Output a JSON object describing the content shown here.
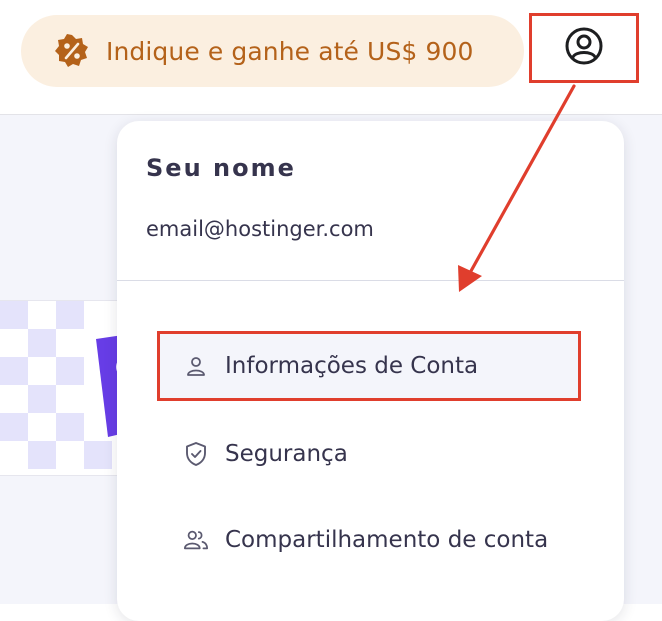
{
  "header": {
    "referral_label": "Indique e ganhe até US$ 900",
    "referral_icon": "discount-badge-icon",
    "account_icon": "user-circle-icon"
  },
  "dropdown": {
    "name": "Seu nome",
    "email": "email@hostinger.com",
    "items": [
      {
        "label": "Informações de Conta",
        "icon": "user-icon",
        "highlighted": true
      },
      {
        "label": "Segurança",
        "icon": "shield-check-icon",
        "highlighted": false
      },
      {
        "label": "Compartilhamento de conta",
        "icon": "users-icon",
        "highlighted": false
      }
    ]
  },
  "colors": {
    "referral_bg": "#fbefe0",
    "referral_text": "#b4621a",
    "annotation_red": "#e03e2d",
    "text_dark": "#36344d",
    "hero_purple": "#673de6"
  }
}
